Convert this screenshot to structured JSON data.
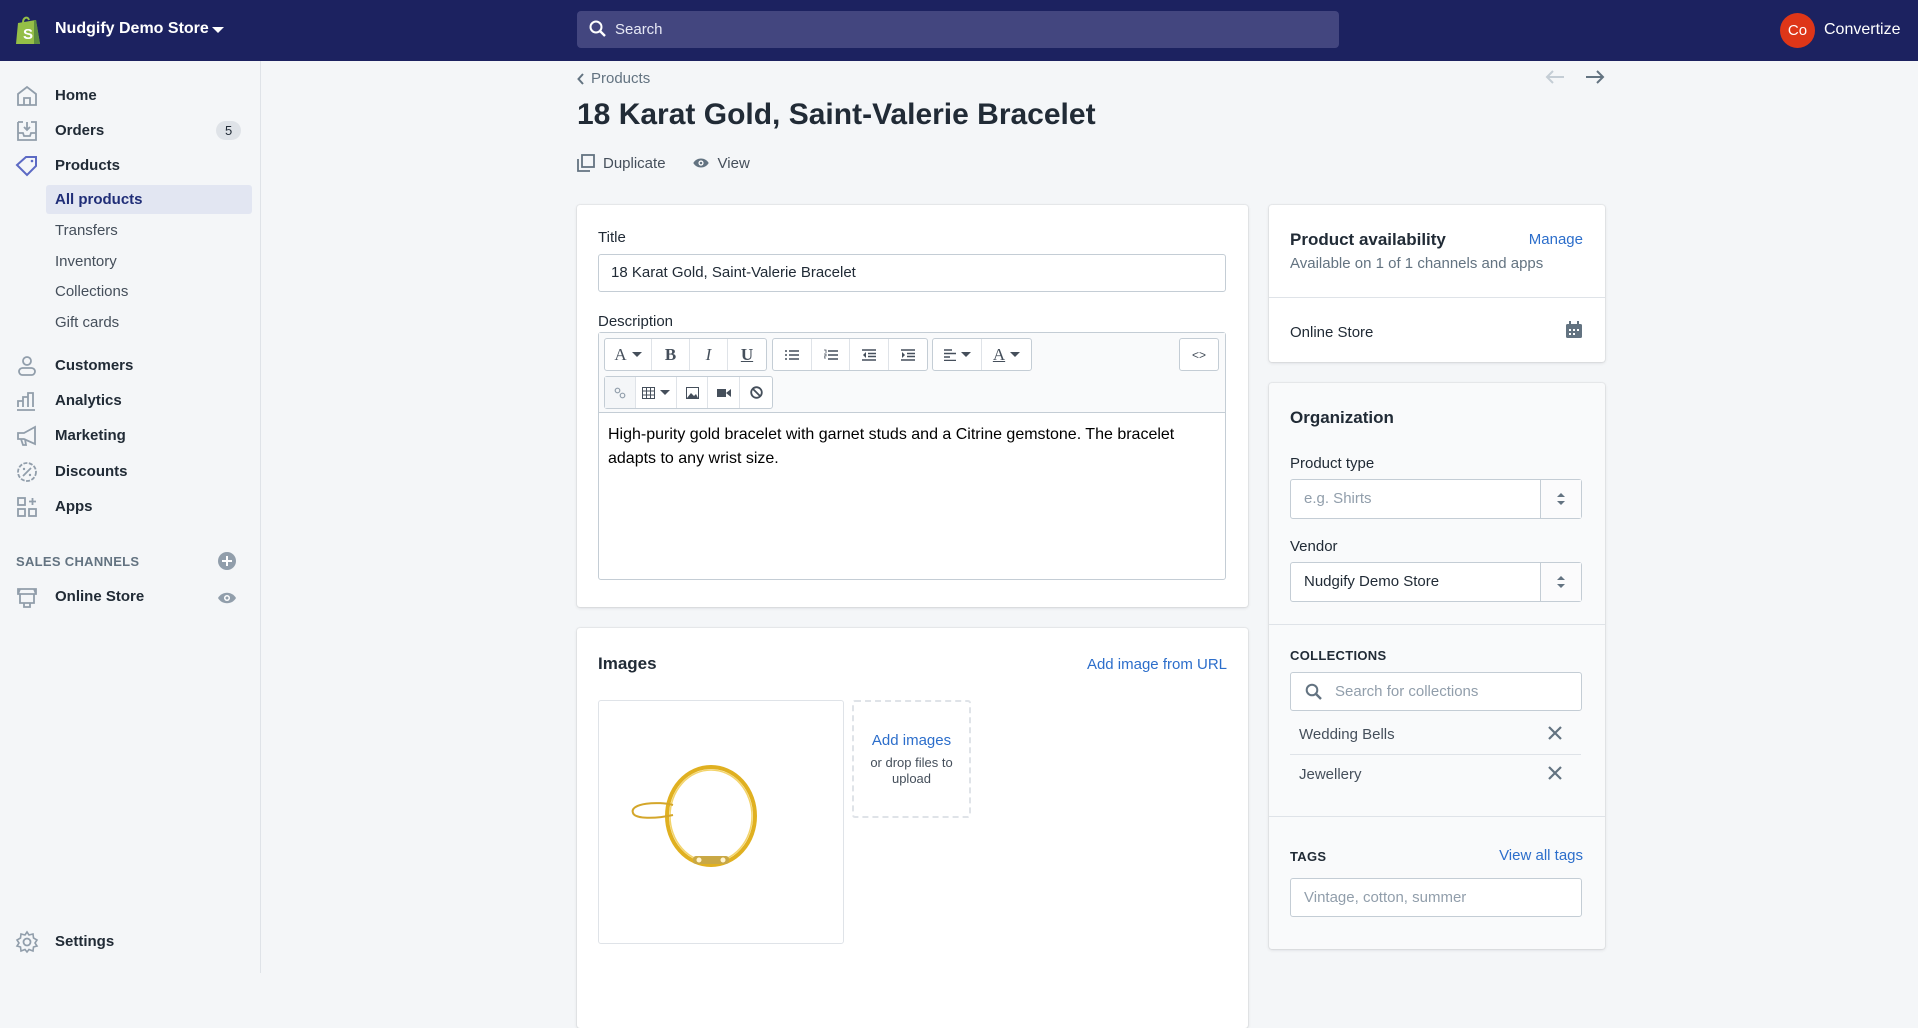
{
  "topbar": {
    "store_name": "Nudgify Demo Store",
    "search_placeholder": "Search",
    "user_initials": "Co",
    "user_name": "Convertize",
    "avatar_color": "#de3618",
    "bg_color": "#1c2260"
  },
  "sidebar": {
    "items": [
      {
        "label": "Home",
        "icon": "home-icon"
      },
      {
        "label": "Orders",
        "icon": "orders-icon",
        "badge": "5"
      },
      {
        "label": "Products",
        "icon": "tag-icon"
      },
      {
        "label": "Customers",
        "icon": "person-icon"
      },
      {
        "label": "Analytics",
        "icon": "bar-chart-icon"
      },
      {
        "label": "Marketing",
        "icon": "megaphone-icon"
      },
      {
        "label": "Discounts",
        "icon": "discount-icon"
      },
      {
        "label": "Apps",
        "icon": "apps-icon"
      }
    ],
    "product_subitems": [
      {
        "label": "All products",
        "active": true
      },
      {
        "label": "Transfers"
      },
      {
        "label": "Inventory"
      },
      {
        "label": "Collections"
      },
      {
        "label": "Gift cards"
      }
    ],
    "sales_channels_header": "SALES CHANNELS",
    "online_store": "Online Store",
    "settings": "Settings"
  },
  "page": {
    "breadcrumb": "Products",
    "title": "18 Karat Gold, Saint-Valerie Bracelet",
    "actions": {
      "duplicate": "Duplicate",
      "view": "View"
    }
  },
  "product_form": {
    "title_label": "Title",
    "title_value": "18 Karat Gold, Saint-Valerie Bracelet",
    "description_label": "Description",
    "description_value": "High-purity gold bracelet with garnet studs and a Citrine gemstone. The bracelet adapts to any wrist size.",
    "toolbar": {
      "bold": "B",
      "italic": "I",
      "underline": "U",
      "font": "A",
      "color": "A",
      "code": "<>"
    }
  },
  "images": {
    "title": "Images",
    "add_from_url": "Add image from URL",
    "add_images": "Add images",
    "drop_hint": "or drop files to upload"
  },
  "availability": {
    "title": "Product availability",
    "manage": "Manage",
    "subtitle": "Available on 1 of 1 channels and apps",
    "channel": "Online Store"
  },
  "organization": {
    "title": "Organization",
    "product_type_label": "Product type",
    "product_type_placeholder": "e.g. Shirts",
    "vendor_label": "Vendor",
    "vendor_value": "Nudgify Demo Store",
    "collections_header": "COLLECTIONS",
    "collections_search_placeholder": "Search for collections",
    "collections": [
      "Wedding Bells",
      "Jewellery"
    ],
    "tags_header": "TAGS",
    "view_all_tags": "View all tags",
    "tags_placeholder": "Vintage, cotton, summer"
  },
  "colors": {
    "link": "#2c6ecb",
    "accent": "#5c6ac4"
  }
}
